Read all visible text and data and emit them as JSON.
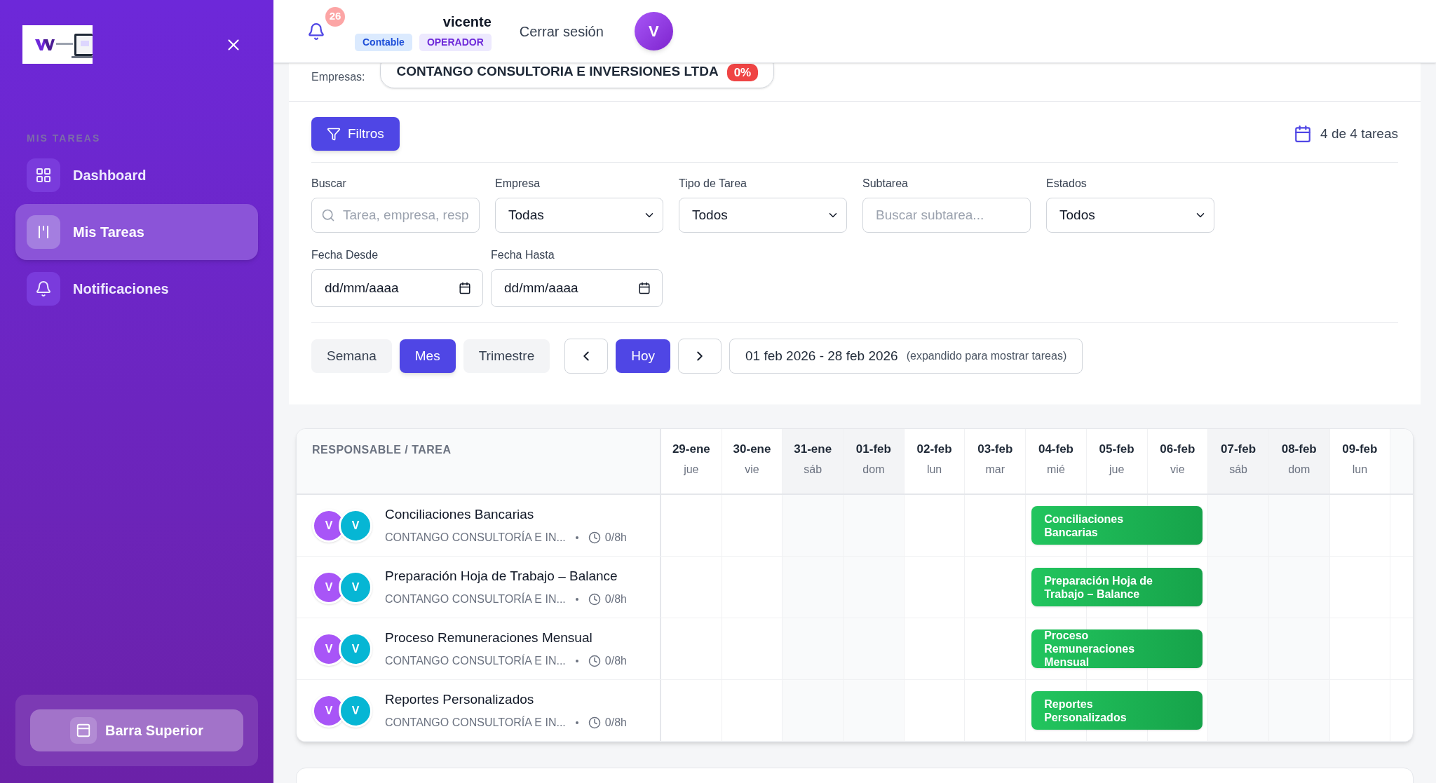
{
  "sidebar": {
    "section_label": "MIS TAREAS",
    "items": [
      {
        "label": "Dashboard",
        "selected": false
      },
      {
        "label": "Mis Tareas",
        "selected": true
      },
      {
        "label": "Notificaciones",
        "selected": false
      }
    ],
    "footer_button": "Barra Superior"
  },
  "header": {
    "notification_count": "26",
    "user_name": "vicente",
    "badges": [
      {
        "label": "Contable",
        "color": "#dbeafe"
      },
      {
        "label": "OPERADOR",
        "color": "#ede9fe"
      }
    ],
    "logout": "Cerrar sesión",
    "avatar": "V"
  },
  "empresas": {
    "label": "Empresas:",
    "company": "CONTANGO CONSULTORIA E INVERSIONES LTDA",
    "percent": "0%"
  },
  "filters_button": "Filtros",
  "task_count": "4 de 4 tareas",
  "fields": [
    {
      "kind": "search",
      "label": "Buscar",
      "placeholder": "Tarea, empresa, resp"
    },
    {
      "kind": "select",
      "label": "Empresa",
      "value": "Todas"
    },
    {
      "kind": "select",
      "label": "Tipo de Tarea",
      "value": "Todos"
    },
    {
      "kind": "text",
      "label": "Subtarea",
      "placeholder": "Buscar subtarea..."
    },
    {
      "kind": "select",
      "label": "Estados",
      "value": "Todos"
    },
    {
      "kind": "date",
      "label": "Fecha Desde",
      "value": "dd/mm/aaaa"
    },
    {
      "kind": "date",
      "label": "Fecha Hasta",
      "value": "dd/mm/aaaa"
    }
  ],
  "view_tabs": [
    {
      "label": "Semana",
      "selected": false
    },
    {
      "label": "Mes",
      "selected": true
    },
    {
      "label": "Trimestre",
      "selected": false
    }
  ],
  "today_button": "Hoy",
  "range": "01 feb 2026 - 28 feb 2026",
  "range_note": "(expandido para mostrar tareas)",
  "gantt": {
    "column_header": "RESPONSABLE / TAREA",
    "days": [
      {
        "date": "29-ene",
        "weekday": "jue",
        "weekend": false
      },
      {
        "date": "30-ene",
        "weekday": "vie",
        "weekend": false
      },
      {
        "date": "31-ene",
        "weekday": "sáb",
        "weekend": true
      },
      {
        "date": "01-feb",
        "weekday": "dom",
        "weekend": true
      },
      {
        "date": "02-feb",
        "weekday": "lun",
        "weekend": false
      },
      {
        "date": "03-feb",
        "weekday": "mar",
        "weekend": false
      },
      {
        "date": "04-feb",
        "weekday": "mié",
        "weekend": false
      },
      {
        "date": "05-feb",
        "weekday": "jue",
        "weekend": false
      },
      {
        "date": "06-feb",
        "weekday": "vie",
        "weekend": false
      },
      {
        "date": "07-feb",
        "weekday": "sáb",
        "weekend": true
      },
      {
        "date": "08-feb",
        "weekday": "dom",
        "weekend": true
      },
      {
        "date": "09-feb",
        "weekday": "lun",
        "weekend": false
      }
    ],
    "rows": [
      {
        "title": "Conciliaciones Bancarias",
        "company": "CONTANGO CONSULTORÍA E IN...",
        "hours": "0/8h",
        "avatars": [
          {
            "initial": "V",
            "color": "#a855f7"
          },
          {
            "initial": "V",
            "color": "#06b6d4"
          }
        ],
        "bar_label": "Conciliaciones Bancarias",
        "scheduled": [
          false,
          false,
          false,
          false,
          false,
          false,
          true,
          true,
          true,
          false,
          false,
          false
        ]
      },
      {
        "title": "Preparación Hoja de Trabajo – Balance",
        "company": "CONTANGO CONSULTORÍA E IN...",
        "hours": "0/8h",
        "avatars": [
          {
            "initial": "V",
            "color": "#a855f7"
          },
          {
            "initial": "V",
            "color": "#06b6d4"
          }
        ],
        "bar_label": "Preparación Hoja de Trabajo – Balance",
        "scheduled": [
          false,
          false,
          false,
          false,
          false,
          false,
          true,
          true,
          true,
          false,
          false,
          false
        ]
      },
      {
        "title": "Proceso Remuneraciones Mensual",
        "company": "CONTANGO CONSULTORÍA E IN...",
        "hours": "0/8h",
        "avatars": [
          {
            "initial": "V",
            "color": "#a855f7"
          },
          {
            "initial": "V",
            "color": "#06b6d4"
          }
        ],
        "bar_label": "Proceso Remuneraciones Mensual",
        "scheduled": [
          false,
          false,
          false,
          false,
          false,
          false,
          true,
          true,
          true,
          false,
          false,
          false
        ]
      },
      {
        "title": "Reportes Personalizados",
        "company": "CONTANGO CONSULTORÍA E IN...",
        "hours": "0/8h",
        "avatars": [
          {
            "initial": "V",
            "color": "#a855f7"
          },
          {
            "initial": "V",
            "color": "#06b6d4"
          }
        ],
        "bar_label": "Reportes Personalizados",
        "scheduled": [
          false,
          false,
          false,
          false,
          false,
          false,
          true,
          true,
          true,
          false,
          false,
          false
        ]
      }
    ]
  }
}
